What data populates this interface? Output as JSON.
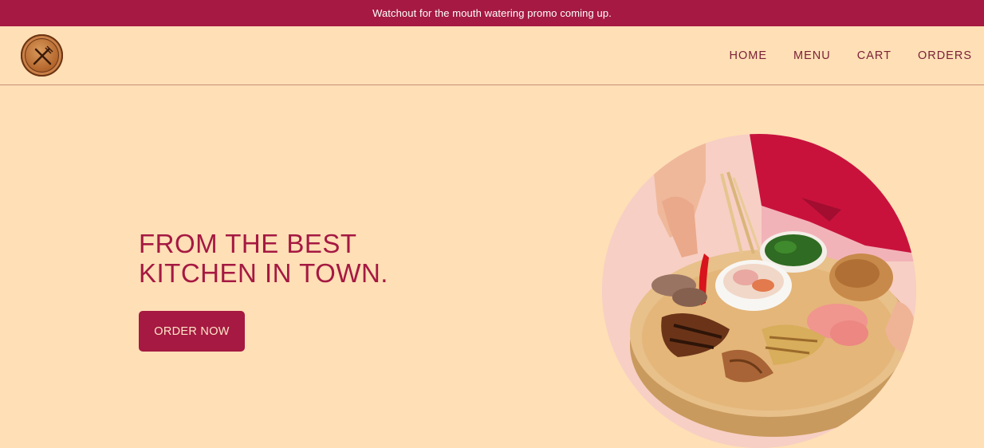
{
  "promo": {
    "text": "Watchout for the mouth watering promo coming up."
  },
  "nav": {
    "logo_icon": "utensils-plate-logo",
    "links": [
      {
        "label": "HOME"
      },
      {
        "label": "MENU"
      },
      {
        "label": "CART"
      },
      {
        "label": "ORDERS"
      }
    ]
  },
  "hero": {
    "title": "FROM THE BEST KITCHEN IN TOWN.",
    "cta_label": "ORDER NOW",
    "image_icon": "food-platter-photo"
  },
  "colors": {
    "brand": "#a51942",
    "background": "#ffdfb6",
    "nav_text": "#7a2236"
  }
}
